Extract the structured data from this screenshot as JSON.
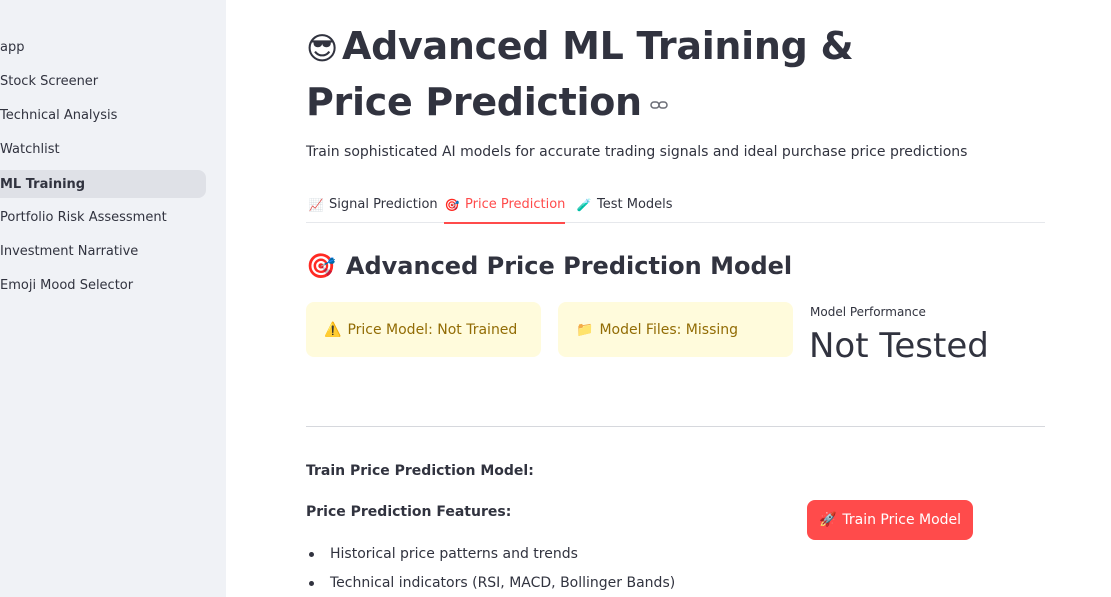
{
  "sidebar": {
    "items": [
      {
        "label": "app",
        "active": false
      },
      {
        "label": "Stock Screener",
        "active": false
      },
      {
        "label": "Technical Analysis",
        "active": false
      },
      {
        "label": "Watchlist",
        "active": false
      },
      {
        "label": "ML Training",
        "active": true
      },
      {
        "label": "Portfolio Risk Assessment",
        "active": false
      },
      {
        "label": "Investment Narrative",
        "active": false
      },
      {
        "label": "Emoji Mood Selector",
        "active": false
      }
    ]
  },
  "page": {
    "title_emoji": "😎",
    "title": "Advanced ML Training & Price Prediction",
    "subtitle": "Train sophisticated AI models for accurate trading signals and ideal purchase price predictions"
  },
  "tabs": [
    {
      "icon": "📈",
      "icon_name": "chart-increasing-icon",
      "label": "Signal Prediction",
      "active": false
    },
    {
      "icon": "🎯",
      "icon_name": "target-icon",
      "label": "Price Prediction",
      "active": true
    },
    {
      "icon": "🧪",
      "icon_name": "test-tube-icon",
      "label": "Test Models",
      "active": false
    }
  ],
  "section": {
    "icon": "🎯",
    "title": "Advanced Price Prediction Model"
  },
  "status": {
    "model": {
      "icon": "⚠️",
      "text": "Price Model: Not Trained"
    },
    "files": {
      "icon": "📁",
      "text": "Model Files: Missing"
    }
  },
  "metric": {
    "label": "Model Performance",
    "value": "Not Tested"
  },
  "training": {
    "heading": "Train Price Prediction Model:",
    "features_heading": "Price Prediction Features:",
    "features": [
      "Historical price patterns and trends",
      "Technical indicators (RSI, MACD, Bollinger Bands)"
    ],
    "button_icon": "🚀",
    "button_label": "Train Price Model"
  },
  "colors": {
    "accent": "#ff4b4b",
    "warning_bg": "#fffbdc",
    "warning_text": "#926c05",
    "sidebar_bg": "#f0f2f6"
  }
}
